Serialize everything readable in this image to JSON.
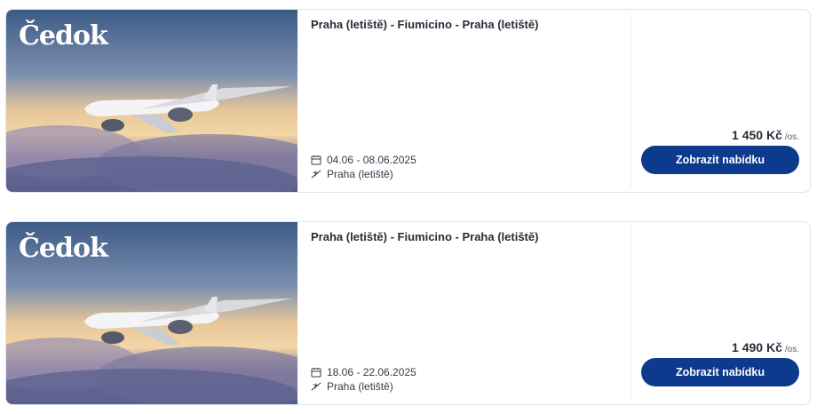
{
  "brand": {
    "logo_text": "Čedok"
  },
  "offers": [
    {
      "route": "Praha (letiště) - Fiumicino - Praha (letiště)",
      "dates": "04.06 - 08.06.2025",
      "departure": "Praha (letiště)",
      "price": "1 450 Kč",
      "price_unit": "/os.",
      "button_label": "Zobrazit nabídku"
    },
    {
      "route": "Praha (letiště) - Fiumicino - Praha (letiště)",
      "dates": "18.06 - 22.06.2025",
      "departure": "Praha (letiště)",
      "price": "1 490 Kč",
      "price_unit": "/os.",
      "button_label": "Zobrazit nabídku"
    }
  ],
  "icons": {
    "dates": "calendar-icon",
    "departure": "plane-departure-icon"
  },
  "colors": {
    "button": "#0d3a8c",
    "border": "#e2e4ea",
    "text": "#2b2b3a"
  }
}
